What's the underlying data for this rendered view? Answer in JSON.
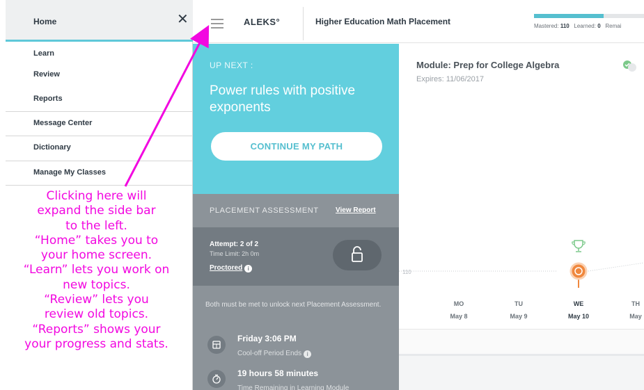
{
  "sidebar": {
    "home_label": "Home",
    "close_glyph": "✕",
    "items": [
      {
        "label": "Learn"
      },
      {
        "label": "Review"
      },
      {
        "label": "Reports"
      },
      {
        "label": "Message Center"
      },
      {
        "label": "Dictionary"
      },
      {
        "label": "Manage My Classes"
      }
    ]
  },
  "annotation": {
    "lines": [
      "Clicking here will",
      "expand the side bar",
      "to the left.",
      "“Home” takes you to",
      "your home screen.",
      "“Learn” lets you work on",
      "new topics.",
      "“Review” lets you",
      "review old topics.",
      "“Reports” shows your",
      "your progress and stats."
    ],
    "color": "#f208e0"
  },
  "header": {
    "logo": "ALEKS°",
    "course_title": "Higher Education Math Placement",
    "progress": {
      "mastered_label": "Mastered:",
      "mastered": "110",
      "learned_label": "Learned:",
      "learned": "0",
      "remaining_label": "Remai",
      "fill_fraction": 0.63
    }
  },
  "up_next": {
    "label": "UP NEXT :",
    "topic": "Power rules with positive exponents",
    "button": "CONTINUE MY PATH"
  },
  "placement": {
    "header": "PLACEMENT ASSESSMENT",
    "view_report": "View Report",
    "attempt": "Attempt: 2 of 2",
    "time_limit": "Time Limit: 2h 0m",
    "proctored": "Proctored",
    "unlock_note": "Both must be met to unlock next Placement Assessment.",
    "condition1_title": "Friday 3:06 PM",
    "condition1_sub": "Cool-off Period Ends",
    "condition2_title": "19 hours 58 minutes",
    "condition2_sub": "Time Remaining in Learning Module"
  },
  "module": {
    "title": "Module: Prep for College Algebra",
    "expires": "Expires: 11/06/2017",
    "chart_level_label": "110",
    "days": [
      {
        "day": "MO",
        "date": "May 8"
      },
      {
        "day": "TU",
        "date": "May 9"
      },
      {
        "day": "WE",
        "date": "May 10",
        "current": true
      },
      {
        "day": "TH",
        "date": "May"
      }
    ]
  },
  "colors": {
    "accent": "#62cfde",
    "accent_dark": "#55bfcf",
    "marker": "#f0883e",
    "panel_gray": "#8c9399",
    "annotation_arrow": "#f208e0"
  }
}
